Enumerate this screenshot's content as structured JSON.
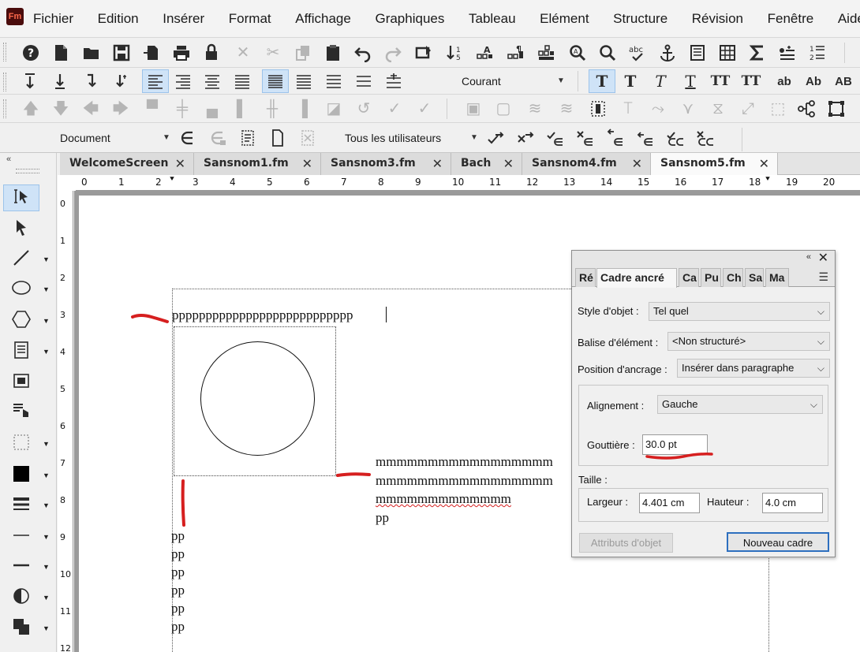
{
  "app": {
    "logo_text": "Fm"
  },
  "menu": [
    "Fichier",
    "Edition",
    "Insérer",
    "Format",
    "Affichage",
    "Graphiques",
    "Tableau",
    "Elément",
    "Structure",
    "Révision",
    "Fenêtre",
    "Aide"
  ],
  "toolbar2": {
    "paragraph_format": "Courant"
  },
  "toolbar3": {},
  "toolbar4": {
    "view_select": "Document",
    "users_select": "Tous les utilisateurs"
  },
  "tabs": [
    {
      "label": "WelcomeScreen",
      "active": false
    },
    {
      "label": "Sansnom1.fm",
      "active": false
    },
    {
      "label": "Sansnom3.fm",
      "active": false
    },
    {
      "label": "Bach",
      "active": false
    },
    {
      "label": "Sansnom4.fm",
      "active": false
    },
    {
      "label": "Sansnom5.fm",
      "active": true
    }
  ],
  "hruler": [
    "0",
    "1",
    "2",
    "3",
    "4",
    "5",
    "6",
    "7",
    "8",
    "9",
    "10",
    "11",
    "12",
    "13",
    "14",
    "15",
    "16",
    "17",
    "18",
    "19",
    "20"
  ],
  "vruler": [
    "0",
    "1",
    "2",
    "3",
    "4",
    "5",
    "6",
    "7",
    "8",
    "9",
    "10",
    "11",
    "12"
  ],
  "document": {
    "line_p": "ppppppppppppppppppppppppppp",
    "m_lines": [
      "mmmmmmmmmmmmmmmmm",
      "mmmmmmmmmmmmmmmmm",
      "mmmmmmmmmmmmm",
      "pp"
    ],
    "pp_lines": [
      "pp",
      "pp",
      "pp",
      "pp",
      "pp",
      "pp"
    ]
  },
  "panel": {
    "tabs": [
      "Ré",
      "Cadre ancré",
      "Ca",
      "Pu",
      "Ch",
      "Sa",
      "Ma"
    ],
    "active_tab": "Cadre ancré",
    "object_style_label": "Style d'objet :",
    "object_style_value": "Tel quel",
    "element_tag_label": "Balise d'élément :",
    "element_tag_value": "<Non structuré>",
    "anchor_position_label": "Position d'ancrage :",
    "anchor_position_value": "Insérer dans paragraphe",
    "alignment_label": "Alignement :",
    "alignment_value": "Gauche",
    "gutter_label": "Gouttière :",
    "gutter_value": "30.0 pt",
    "size_label": "Taille :",
    "width_label": "Largeur :",
    "width_value": "4.401 cm",
    "height_label": "Hauteur :",
    "height_value": "4.0 cm",
    "object_attributes_button": "Attributs d'objet",
    "new_frame_button": "Nouveau cadre"
  },
  "colors": {
    "annotation_red": "#d61f1f",
    "selection_blue": "#cfe3f7",
    "default_button_border": "#2d6fbf"
  }
}
